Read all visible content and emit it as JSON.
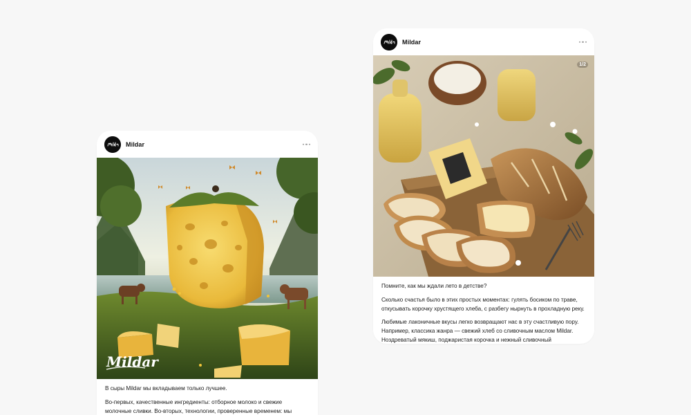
{
  "posts": [
    {
      "account": "Mildar",
      "photo_watermark": "Mildar",
      "paragraphs": [
        "В сыры Mildar мы вкладываем только лучшее.",
        "Во-первых, качественные ингредиенты: отборное молоко и свежие молочные сливки. Во-вторых, технологии, проверенные временем: мы"
      ]
    },
    {
      "account": "Mildar",
      "slide_counter": "1/2",
      "paragraphs": [
        "Помните, как мы ждали лето в детстве?",
        "Сколько счастья было в этих простых моментах: гулять босиком по траве, откусывать корочку хрустящего хлеба, с разбегу нырнуть в прохладную реку.",
        "Любимые лаконичные вкусы легко возвращают нас в эту счастливую пору. Например, классика жанра — свежий хлеб со сливочным маслом Mildar. Ноздреватый мякиш, поджаристая корочка и нежный сливочный"
      ]
    }
  ],
  "icons": {
    "more": "more-horizontal-icon",
    "avatar": "brand-logo-icon"
  },
  "colors": {
    "page_background": "#f7f7f7",
    "card_background": "#ffffff",
    "text": "#1a1a1a"
  }
}
